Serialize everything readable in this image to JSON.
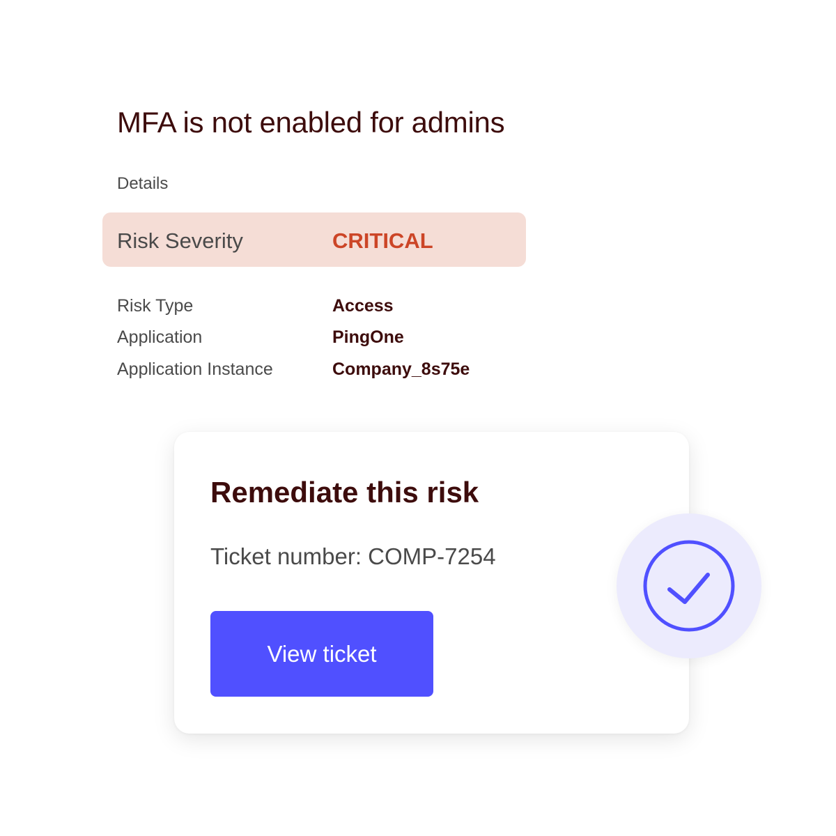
{
  "risk": {
    "title": "MFA is not enabled for admins",
    "details_label": "Details",
    "severity": {
      "label": "Risk Severity",
      "value": "CRITICAL"
    },
    "fields": [
      {
        "label": "Risk Type",
        "value": "Access"
      },
      {
        "label": "Application",
        "value": "PingOne"
      },
      {
        "label": "Application Instance",
        "value": "Company_8s75e"
      }
    ]
  },
  "remediation": {
    "title": "Remediate this risk",
    "ticket_text": "Ticket number: COMP-7254",
    "button_label": "View ticket"
  },
  "badge": {
    "icon": "check-circle-icon"
  },
  "colors": {
    "title": "#3d0c0c",
    "critical": "#cc4527",
    "severity_bg": "#f5ddd6",
    "button": "#5050ff",
    "badge_bg": "#ecebfd"
  }
}
